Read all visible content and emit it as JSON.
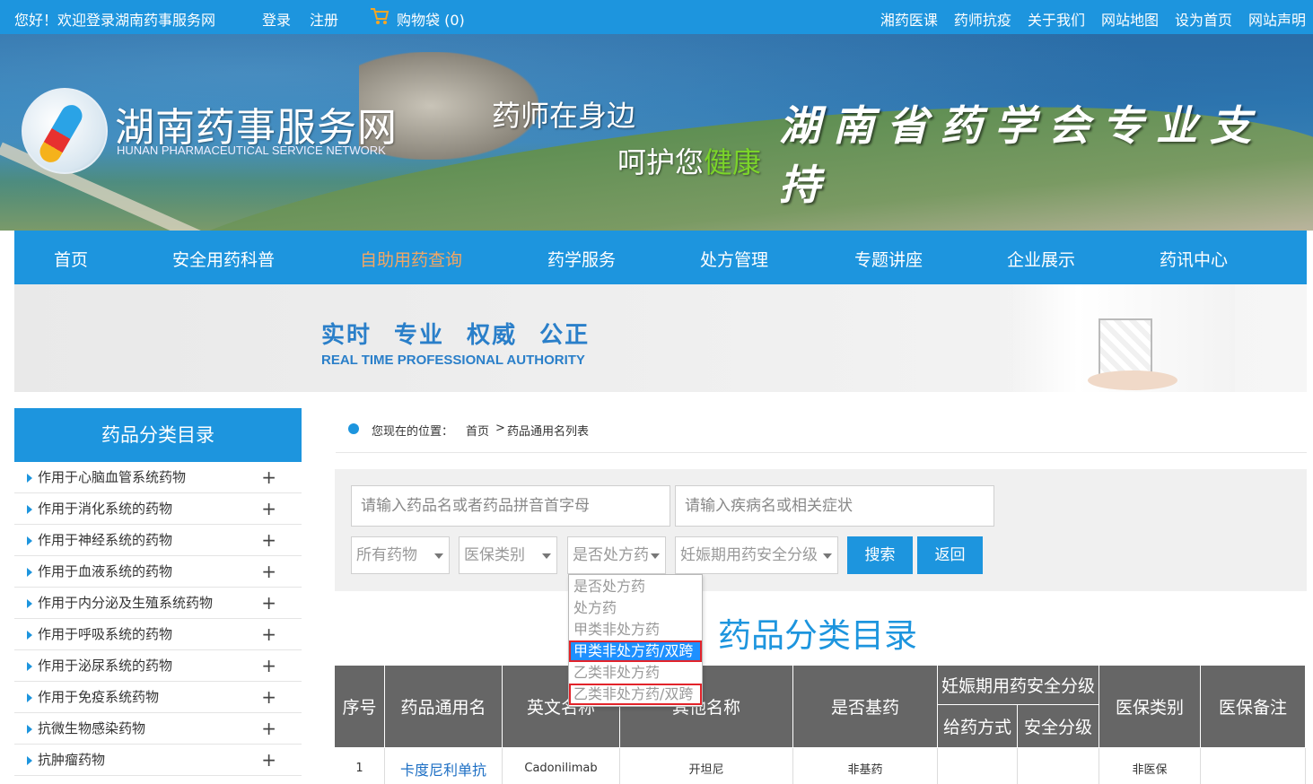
{
  "topbar": {
    "welcome": "您好！欢迎登录湖南药事服务网",
    "login": "登录",
    "register": "注册",
    "cart": "购物袋 (0)",
    "links": [
      "湘药医课",
      "药师抗疫",
      "关于我们",
      "网站地图",
      "设为首页",
      "网站声明"
    ]
  },
  "banner": {
    "site_name": "湖南药事服务网",
    "site_en": "HUNAN PHARMACEUTICAL SERVICE NETWORK",
    "slogan1": "药师在身边",
    "slogan2_pre": "呵护您",
    "slogan2_hl": "健康",
    "support": "湖南省药学会专业支持"
  },
  "nav": {
    "items": [
      "首页",
      "安全用药科普",
      "自助用药查询",
      "药学服务",
      "处方管理",
      "专题讲座",
      "企业展示",
      "药讯中心"
    ],
    "active": "自助用药查询"
  },
  "subbanner": {
    "slogan_cn": "实时  专业  权威  公正",
    "slogan_en": "REAL TIME PROFESSIONAL AUTHORITY"
  },
  "sidebar": {
    "title": "药品分类目录",
    "items": [
      "作用于心脑血管系统药物",
      "作用于消化系统的药物",
      "作用于神经系统的药物",
      "作用于血液系统的药物",
      "作用于内分泌及生殖系统药物",
      "作用于呼吸系统的药物",
      "作用于泌尿系统的药物",
      "作用于免疫系统药物",
      "抗微生物感染药物",
      "抗肿瘤药物"
    ],
    "expand_symbol": "+"
  },
  "breadcrumb": {
    "label": "您现在的位置：",
    "home": "首页",
    "sep": ">",
    "current": "药品通用名列表"
  },
  "search": {
    "drug_placeholder": "请输入药品名或者药品拼音首字母",
    "disease_placeholder": "请输入疾病名或相关症状",
    "filter_drugs": "所有药物",
    "filter_insurance": "医保类别",
    "filter_prescription": "是否处方药",
    "filter_pregnancy": "妊娠期用药安全分级",
    "search_button": "搜索",
    "back_button": "返回"
  },
  "dropdown": {
    "options": [
      "是否处方药",
      "处方药",
      "甲类非处方药",
      "甲类非处方药/双跨",
      "乙类非处方药",
      "乙类非处方药/双跨"
    ],
    "highlighted": "甲类非处方药/双跨"
  },
  "catalog_title": "药品分类目录",
  "table": {
    "headers": {
      "index": "序号",
      "generic_name": "药品通用名",
      "english_name": "英文名称",
      "other_name": "其他名称",
      "essential": "是否基药",
      "pregnancy_group": "妊娠期用药安全分级",
      "route": "给药方式",
      "safety_level": "安全分级",
      "insurance": "医保类别",
      "insurance_note": "医保备注"
    },
    "rows": [
      {
        "index": "1",
        "generic_name": "卡度尼利单抗",
        "english_name": "Cadonilimab",
        "other_name": "开坦尼",
        "essential": "非基药",
        "route": "",
        "safety_level": "",
        "insurance": "非医保",
        "insurance_note": ""
      }
    ]
  },
  "colors": {
    "primary": "#1d95de",
    "nav_active": "#f3a663",
    "table_header": "#666666",
    "highlight_border": "#e2232a"
  }
}
